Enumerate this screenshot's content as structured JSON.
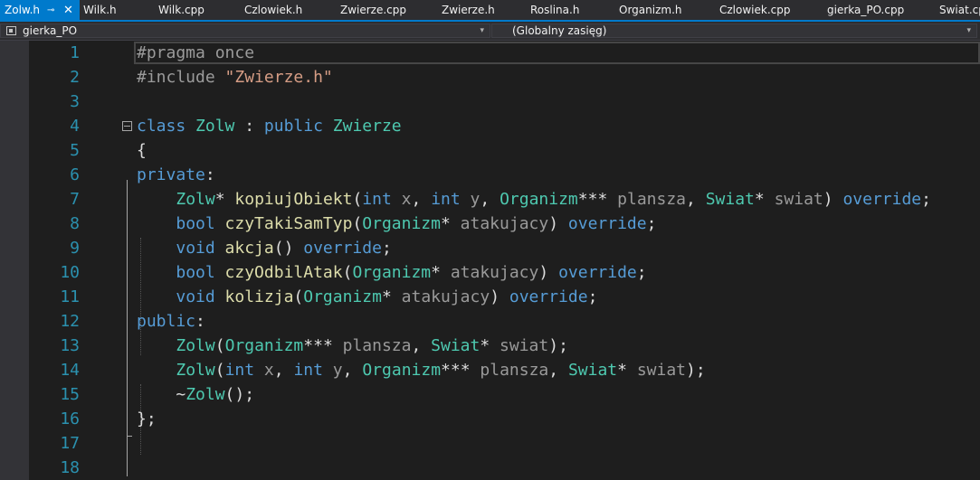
{
  "tabs": [
    {
      "label": "Zolw.h",
      "active": true
    },
    {
      "label": "Wilk.h"
    },
    {
      "label": "Wilk.cpp"
    },
    {
      "label": "Czlowiek.h"
    },
    {
      "label": "Zwierze.cpp"
    },
    {
      "label": "Zwierze.h"
    },
    {
      "label": "Roslina.h"
    },
    {
      "label": "Organizm.h"
    },
    {
      "label": "Czlowiek.cpp"
    },
    {
      "label": "gierka_PO.cpp"
    },
    {
      "label": "Swiat.cp"
    }
  ],
  "active_tab": {
    "pin_glyph": "⊸",
    "close_glyph": "✕"
  },
  "navbar": {
    "project": "gierka_PO",
    "scope": "(Globalny zasięg)",
    "chevron": "▾"
  },
  "icons": {
    "fold": "collapse-region-icon",
    "project": "project-icon",
    "pin": "pin-icon",
    "close": "close-icon"
  },
  "colors": {
    "accent": "#007acc",
    "keyword": "#569cd6",
    "type": "#4ec9b0",
    "function": "#dcdcaa",
    "string": "#d69d85",
    "line_number": "#2b91af"
  },
  "editor": {
    "current_line": 1,
    "lines": [
      {
        "n": "1",
        "tokens": [
          [
            "pp",
            "#pragma once"
          ]
        ]
      },
      {
        "n": "2",
        "tokens": [
          [
            "pp",
            "#include "
          ],
          [
            "str",
            "\"Zwierze.h\""
          ]
        ]
      },
      {
        "n": "3",
        "tokens": []
      },
      {
        "n": "4",
        "tokens": [
          [
            "kw",
            "class "
          ],
          [
            "ty",
            "Zolw"
          ],
          [
            "",
            " : "
          ],
          [
            "kw",
            "public "
          ],
          [
            "ty",
            "Zwierze"
          ]
        ]
      },
      {
        "n": "5",
        "tokens": [
          [
            "",
            "{"
          ]
        ]
      },
      {
        "n": "6",
        "tokens": [
          [
            "kw",
            "private"
          ],
          [
            "",
            ":"
          ]
        ]
      },
      {
        "n": "7",
        "tokens": [
          [
            "",
            "    "
          ],
          [
            "ty",
            "Zolw"
          ],
          [
            "",
            "* "
          ],
          [
            "fn",
            "kopiujObiekt"
          ],
          [
            "",
            "("
          ],
          [
            "kw",
            "int"
          ],
          [
            "param",
            " x"
          ],
          [
            "",
            ", "
          ],
          [
            "kw",
            "int"
          ],
          [
            "param",
            " y"
          ],
          [
            "",
            ", "
          ],
          [
            "ty",
            "Organizm"
          ],
          [
            "",
            "*** "
          ],
          [
            "param",
            "plansza"
          ],
          [
            "",
            ", "
          ],
          [
            "ty",
            "Swiat"
          ],
          [
            "",
            "* "
          ],
          [
            "param",
            "swiat"
          ],
          [
            "",
            ") "
          ],
          [
            "kw",
            "override"
          ],
          [
            "",
            ";"
          ]
        ]
      },
      {
        "n": "8",
        "tokens": [
          [
            "",
            "    "
          ],
          [
            "kw",
            "bool "
          ],
          [
            "fn",
            "czyTakiSamTyp"
          ],
          [
            "",
            "("
          ],
          [
            "ty",
            "Organizm"
          ],
          [
            "",
            "* "
          ],
          [
            "param",
            "atakujacy"
          ],
          [
            "",
            ") "
          ],
          [
            "kw",
            "override"
          ],
          [
            "",
            ";"
          ]
        ]
      },
      {
        "n": "9",
        "tokens": [
          [
            "",
            "    "
          ],
          [
            "kw",
            "void "
          ],
          [
            "fn",
            "akcja"
          ],
          [
            "",
            "() "
          ],
          [
            "kw",
            "override"
          ],
          [
            "",
            ";"
          ]
        ]
      },
      {
        "n": "10",
        "tokens": [
          [
            "",
            "    "
          ],
          [
            "kw",
            "bool "
          ],
          [
            "fn",
            "czyOdbilAtak"
          ],
          [
            "",
            "("
          ],
          [
            "ty",
            "Organizm"
          ],
          [
            "",
            "* "
          ],
          [
            "param",
            "atakujacy"
          ],
          [
            "",
            ") "
          ],
          [
            "kw",
            "override"
          ],
          [
            "",
            ";"
          ]
        ]
      },
      {
        "n": "11",
        "tokens": [
          [
            "",
            "    "
          ],
          [
            "kw",
            "void "
          ],
          [
            "fn",
            "kolizja"
          ],
          [
            "",
            "("
          ],
          [
            "ty",
            "Organizm"
          ],
          [
            "",
            "* "
          ],
          [
            "param",
            "atakujacy"
          ],
          [
            "",
            ") "
          ],
          [
            "kw",
            "override"
          ],
          [
            "",
            ";"
          ]
        ]
      },
      {
        "n": "12",
        "tokens": [
          [
            "kw",
            "public"
          ],
          [
            "",
            ":"
          ]
        ]
      },
      {
        "n": "13",
        "tokens": [
          [
            "",
            "    "
          ],
          [
            "ty",
            "Zolw"
          ],
          [
            "",
            "("
          ],
          [
            "ty",
            "Organizm"
          ],
          [
            "",
            "*** "
          ],
          [
            "param",
            "plansza"
          ],
          [
            "",
            ", "
          ],
          [
            "ty",
            "Swiat"
          ],
          [
            "",
            "* "
          ],
          [
            "param",
            "swiat"
          ],
          [
            "",
            ");"
          ]
        ]
      },
      {
        "n": "14",
        "tokens": [
          [
            "",
            "    "
          ],
          [
            "ty",
            "Zolw"
          ],
          [
            "",
            "("
          ],
          [
            "kw",
            "int"
          ],
          [
            "param",
            " x"
          ],
          [
            "",
            ", "
          ],
          [
            "kw",
            "int"
          ],
          [
            "param",
            " y"
          ],
          [
            "",
            ", "
          ],
          [
            "ty",
            "Organizm"
          ],
          [
            "",
            "*** "
          ],
          [
            "param",
            "plansza"
          ],
          [
            "",
            ", "
          ],
          [
            "ty",
            "Swiat"
          ],
          [
            "",
            "* "
          ],
          [
            "param",
            "swiat"
          ],
          [
            "",
            ");"
          ]
        ]
      },
      {
        "n": "15",
        "tokens": [
          [
            "",
            "    ~"
          ],
          [
            "ty",
            "Zolw"
          ],
          [
            "",
            "();"
          ]
        ]
      },
      {
        "n": "16",
        "tokens": [
          [
            "",
            "};"
          ]
        ]
      },
      {
        "n": "17",
        "tokens": []
      },
      {
        "n": "18",
        "tokens": []
      }
    ]
  }
}
